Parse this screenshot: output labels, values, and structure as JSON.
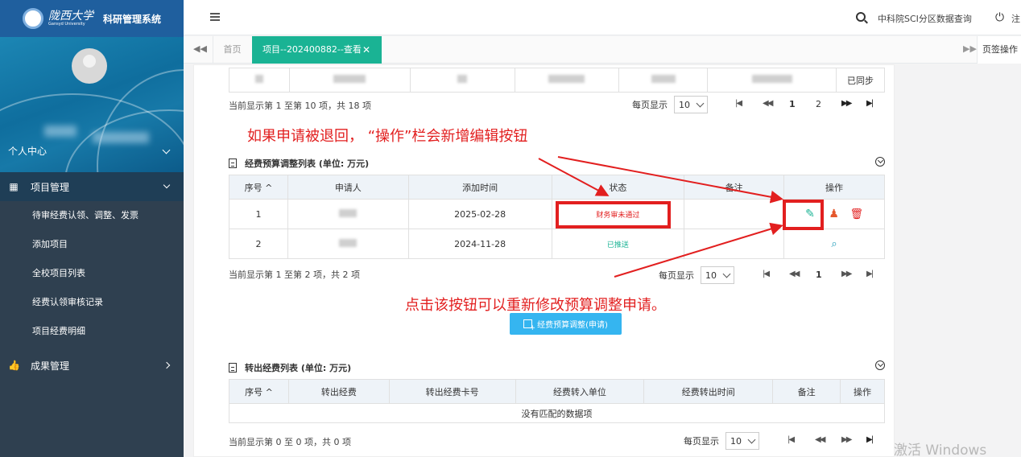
{
  "sidebar": {
    "brand_cn": "陇西大学",
    "brand_en": "Gansyd University",
    "system_name": "科研管理系统",
    "profile_label": "个人中心",
    "menu": {
      "project_label": "项目管理",
      "sub_items": [
        "待审经费认领、调整、发票",
        "添加项目",
        "全校项目列表",
        "经费认领审核记录",
        "项目经费明细"
      ],
      "results_label": "成果管理"
    }
  },
  "topbar": {
    "search_link": "中科院SCI分区数据查询",
    "power_label": "注"
  },
  "tabs": {
    "home": "首页",
    "active": "项目--202400882--查看",
    "close_glyph": "✕",
    "ops": "页签操作"
  },
  "top_table": {
    "last_status": "已同步",
    "info": "当前显示第 1 至第 10 项，共 18 项",
    "per_page_label": "每页显示",
    "per_page_value": "10",
    "pages": [
      "1",
      "2"
    ]
  },
  "annotations": {
    "top": "如果申请被退回，  “操作”栏会新增编辑按钮",
    "middle": "点击该按钮可以重新修改预算调整申请。"
  },
  "budget_table": {
    "title": "经费预算调整列表 (单位: 万元)",
    "headers": [
      "序号 ^",
      "申请人",
      "添加时间",
      "状态",
      "备注",
      "操作"
    ],
    "rows": [
      {
        "index": "1",
        "date": "2025-02-28",
        "status": "财务审未通过"
      },
      {
        "index": "2",
        "date": "2024-11-28",
        "status": "已推送"
      }
    ],
    "info": "当前显示第 1 至第 2 项，共 2 项",
    "per_page_label": "每页显示",
    "per_page_value": "10",
    "page": "1",
    "apply_button": "经费预算调整(申请)"
  },
  "transfer_table": {
    "title": "转出经费列表 (单位: 万元)",
    "headers": [
      "序号 ^",
      "转出经费",
      "转出经费卡号",
      "经费转入单位",
      "经费转出时间",
      "备注",
      "操作"
    ],
    "empty": "没有匹配的数据项",
    "info": "当前显示第 0 至 0 项，共 0 项",
    "per_page_label": "每页显示",
    "per_page_value": "10"
  },
  "watermark": "激活 Windows",
  "colors": {
    "accent": "#1ab394",
    "sidebar": "#2f4050",
    "annotation": "#e21f1f",
    "button": "#35b5f0"
  },
  "icons": [
    "menu-icon",
    "search-icon",
    "power-icon",
    "edit-icon",
    "stamp-icon",
    "delete-icon",
    "view-icon",
    "document-icon",
    "collapse-icon"
  ]
}
